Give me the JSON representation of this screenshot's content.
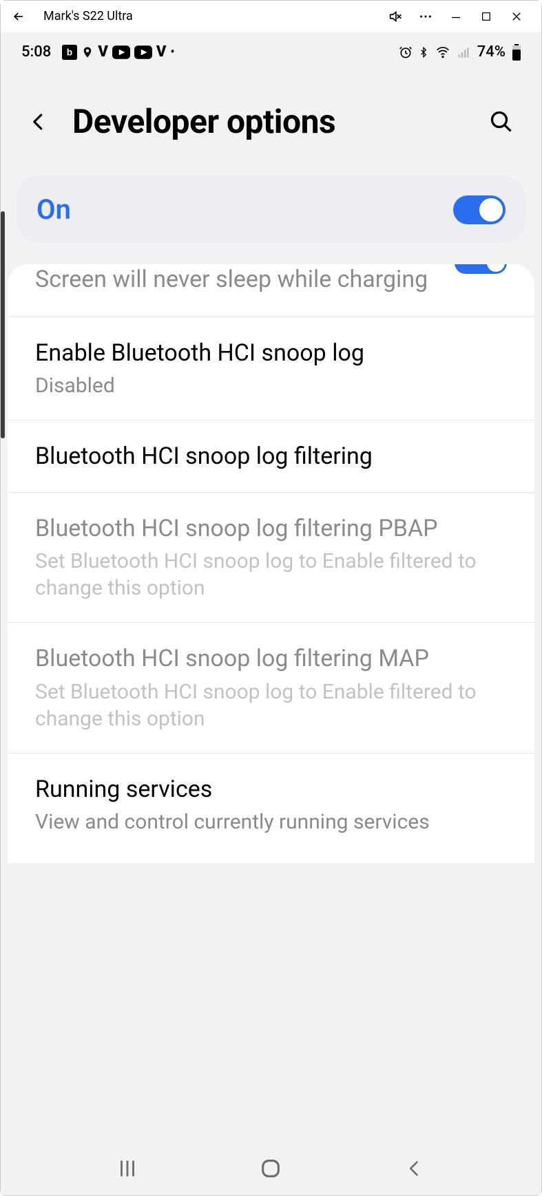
{
  "window": {
    "title": "Mark's S22 Ultra"
  },
  "status": {
    "time": "5:08",
    "battery": "74%"
  },
  "header": {
    "title": "Developer options"
  },
  "master": {
    "label": "On"
  },
  "cutoff": {
    "text": "Screen will never sleep while charging"
  },
  "rows": {
    "r1": {
      "title": "Enable Bluetooth HCI snoop log",
      "sub": "Disabled"
    },
    "r2": {
      "title": "Bluetooth HCI snoop log filtering"
    },
    "r3": {
      "title": "Bluetooth HCI snoop log filtering PBAP",
      "sub": "Set Bluetooth HCI snoop log to Enable filtered to change this option"
    },
    "r4": {
      "title": "Bluetooth HCI snoop log filtering MAP",
      "sub": "Set Bluetooth HCI snoop log to Enable filtered to change this option"
    },
    "r5": {
      "title": "Running services",
      "sub": "View and control currently running services"
    }
  }
}
